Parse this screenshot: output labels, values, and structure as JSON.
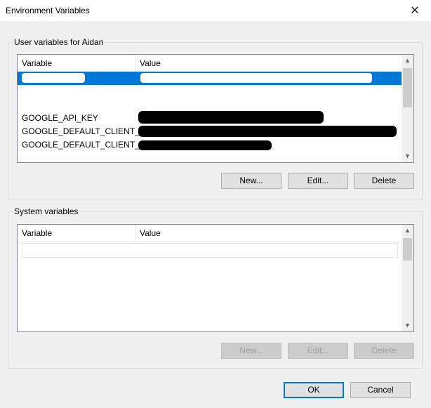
{
  "window": {
    "title": "Environment Variables",
    "close_symbol": "✕"
  },
  "user_vars": {
    "group_label": "User variables for Aidan",
    "columns": [
      "Variable",
      "Value"
    ],
    "rows": [
      {
        "name": "GOOGLE_API_KEY"
      },
      {
        "name": "GOOGLE_DEFAULT_CLIENT_ID"
      },
      {
        "name": "GOOGLE_DEFAULT_CLIENT_..."
      }
    ],
    "buttons": {
      "new": "New...",
      "edit": "Edit...",
      "delete": "Delete"
    }
  },
  "system_vars": {
    "group_label": "System variables",
    "columns": [
      "Variable",
      "Value"
    ],
    "buttons": {
      "new": "New...",
      "edit": "Edit...",
      "delete": "Delete"
    }
  },
  "footer": {
    "ok": "OK",
    "cancel": "Cancel"
  },
  "icons": {
    "scroll_up": "▲",
    "scroll_down": "▼"
  },
  "colors": {
    "selection": "#0078d7",
    "default_button_border": "#0078d7"
  }
}
